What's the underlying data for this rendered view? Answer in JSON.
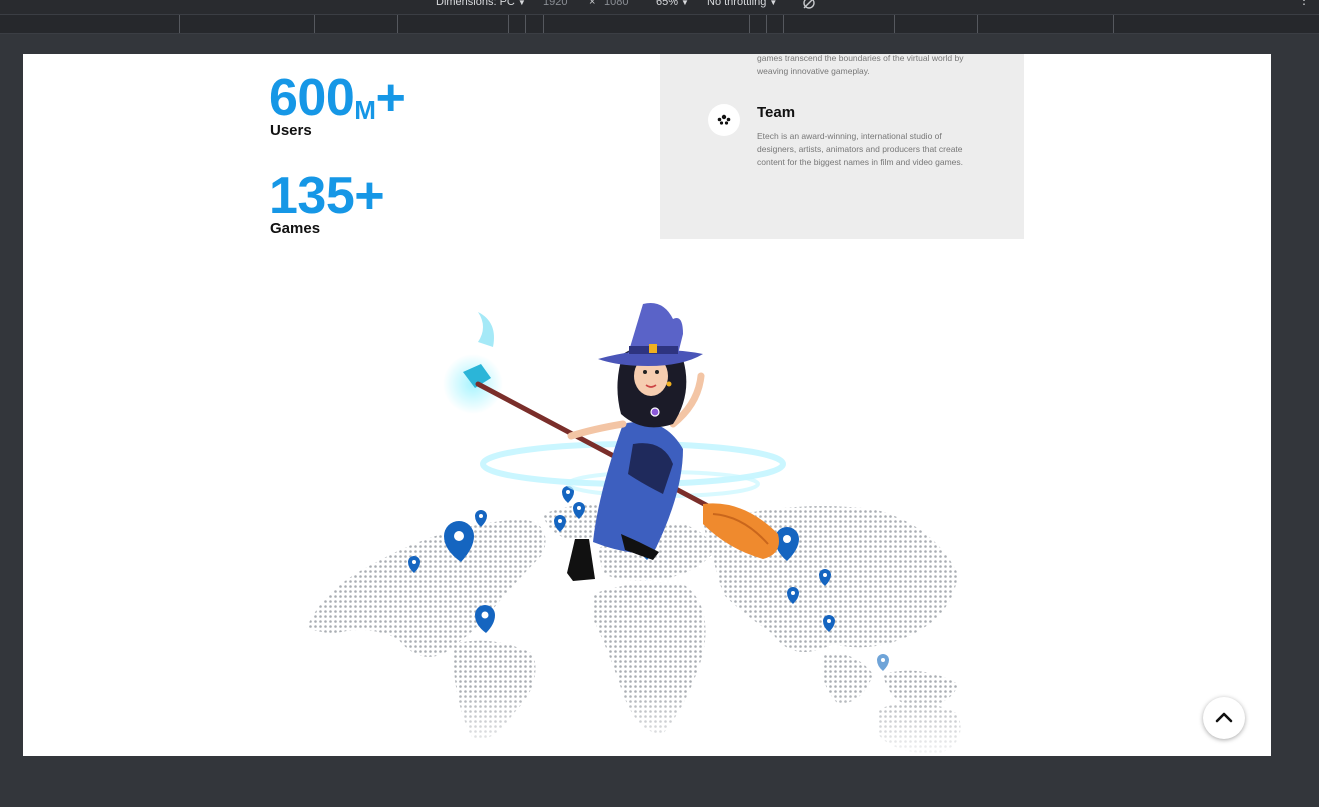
{
  "devtools": {
    "dimensions_label": "Dimensions: PC",
    "width": "1920",
    "height": "1080",
    "zoom": "65%",
    "throttling": "No throttling"
  },
  "stats": [
    {
      "number": "600",
      "unit": "M",
      "suffix": "+",
      "label": "Users"
    },
    {
      "number": "135",
      "unit": "",
      "suffix": "+",
      "label": "Games"
    }
  ],
  "card": {
    "partial_description": "games transcend the boundaries of the virtual world by weaving innovative gameplay.",
    "team_title": "Team",
    "team_description": "Etech is an award-winning, international studio of designers, artists, animators and producers that create content for the biggest names in film and video games.",
    "team_icon": "people-group-icon"
  },
  "hero": {
    "illustration": "witch-on-broom-over-world-map",
    "pin_color": "#1565c0"
  },
  "colors": {
    "accent": "#1697e6",
    "card_bg": "#ededed"
  },
  "scroll_top_icon": "chevron-up-icon"
}
